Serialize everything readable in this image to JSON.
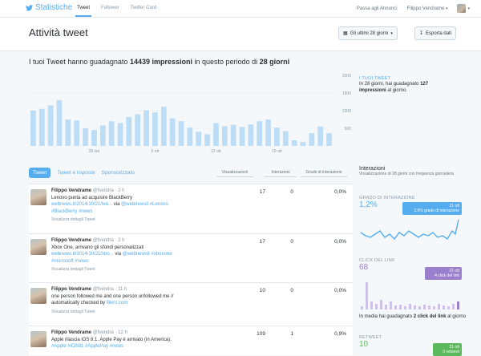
{
  "topbar": {
    "brand": "Statistiche",
    "nav": [
      "Tweet",
      "Follower",
      "Twitter Card"
    ],
    "ads_link": "Passa agli Annunci",
    "user": "Filippo Vendrame"
  },
  "header": {
    "title": "Attività tweet",
    "period_label": "Gli ultimi 28 giorni",
    "export_label": "Esporta dati"
  },
  "summary": {
    "prefix": "I tuoi Tweet hanno guadagnato",
    "impressions": "14439 impressioni",
    "middle": "in questo periodo di",
    "period": "28 giorni"
  },
  "chart_data": {
    "type": "bar",
    "x_tick_labels": [
      "28 set",
      "5 ott",
      "12 ott",
      "19 ott"
    ],
    "y_tick_labels": [
      "2000",
      "1500",
      "1000",
      "500"
    ],
    "ylim": [
      0,
      2000
    ],
    "values": [
      1000,
      1050,
      1150,
      1300,
      750,
      720,
      500,
      450,
      580,
      700,
      650,
      820,
      900,
      1010,
      950,
      1110,
      780,
      700,
      520,
      400,
      330,
      650,
      560,
      600,
      540,
      610,
      700,
      750,
      520,
      420,
      160,
      110,
      360,
      550,
      360
    ],
    "color": "#bddcf5"
  },
  "side_summary": {
    "caption": "I TUOI TWEET",
    "text_a": "In 28 giorni, hai guadagnato",
    "value": "127",
    "text_b": "impressioni",
    "text_c": "al giorno."
  },
  "tabs": [
    "Tweet",
    "Tweet e risposte",
    "Sponsorizzato"
  ],
  "columns": [
    "Visualizzazioni",
    "Interazioni",
    "Grado di interazione"
  ],
  "tweets": [
    {
      "name": "Filippo Vendrame",
      "handle": "@fvendra · 2 h",
      "text1": "Lenovo punta ad acquisire BlackBerry",
      "link": "webnews.it/2014/10/21/len...",
      "via": "via",
      "tags1": "@webnewsit #Lenovo",
      "tags2": "#BlackBerry #news",
      "details": "Visualizza dettagli Tweet",
      "views": "17",
      "interactions": "0",
      "rate": "0,0%"
    },
    {
      "name": "Filippo Vendrame",
      "handle": "@fvendra · 2 h",
      "text1": "Xbox One, arrivano gli sfondi personalizzati",
      "link": "webnews.it/2014/10/21/xbo...",
      "via": "via",
      "tags1": "@webnewsit #xboxone",
      "tags2": "#microsoft #news",
      "details": "Visualizza dettagli Tweet",
      "views": "17",
      "interactions": "0",
      "rate": "0,0%"
    },
    {
      "name": "Filippo Vendrame",
      "handle": "@fvendra · 11 h",
      "text1": "one person followed me and one person unfollowed me //",
      "text2": "automatically checked by",
      "link": "fllwrs.com",
      "details": "Visualizza dettagli Tweet",
      "views": "10",
      "interactions": "0",
      "rate": "0,0%"
    },
    {
      "name": "Filippo Vendrame",
      "handle": "@fvendra · 12 h",
      "text1": "Apple rilascia iOS 8.1. Apple Pay è arrivato (in America).",
      "tags2": "#Apple #iOS81 #ApplePay #news",
      "views": "109",
      "interactions": "1",
      "rate": "0,9%"
    }
  ],
  "interactions_panel": {
    "title": "Interazioni",
    "subtitle": "Visualizzazione di 28 giorni con frequenza giornaliera",
    "rate_caption": "GRADO DI INTERAZIONE",
    "rate_value": "1,2%",
    "rate_callout_date": "21 ott",
    "rate_callout_text": "3,6% grado di interazione",
    "clicks_caption": "CLICK DEL LINK",
    "clicks_value": "68",
    "clicks_callout_date": "21 ott",
    "clicks_callout_text": "4 click del link",
    "clicks_avg_a": "In media hai guadagnato",
    "clicks_avg_b": "2 click del link",
    "clicks_avg_c": "al giorno",
    "retweet_caption": "RETWEET",
    "retweet_value": "10",
    "retweet_callout_date": "21 ott",
    "retweet_callout_text": "0 retweet"
  },
  "colors": {
    "accent": "#55acee",
    "clicks": "#9a7fcc",
    "retweet": "#5cb85c",
    "bar": "#bddcf5"
  }
}
